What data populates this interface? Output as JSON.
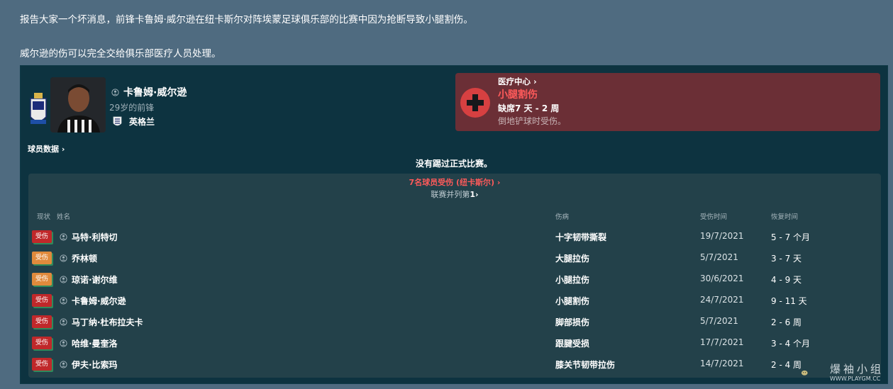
{
  "message": {
    "line1": "报告大家一个坏消息，前锋卡鲁姆·威尔逊在纽卡斯尔对阵埃蒙足球俱乐部的比赛中因为抢断导致小腿割伤。",
    "line2": "威尔逊的伤可以完全交给俱乐部医疗人员处理。"
  },
  "player": {
    "name": "卡鲁姆·威尔逊",
    "age_position": "29岁的前锋",
    "nation": "英格兰",
    "data_link": "球员数据 ›"
  },
  "medical": {
    "link": "医疗中心 ›",
    "injury": "小腿割伤",
    "absence": "缺席7 天 - 2 周",
    "cause": "倒地铲球时受伤。",
    "accent_color": "#d64041"
  },
  "no_match_text": "没有踢过正式比赛。",
  "injury_list": {
    "heading": "7名球员受伤 (纽卡斯尔) ›",
    "league_rank_prefix": "联赛并列第",
    "league_rank_value": "1",
    "league_rank_suffix": "›",
    "columns": {
      "status": "现状",
      "name": "姓名",
      "injury": "伤病",
      "date": "受伤时间",
      "recovery": "恢复时间"
    },
    "rows": [
      {
        "status": "受伤",
        "severity": "red",
        "name": "马特·利特切",
        "injury": "十字韧带撕裂",
        "date": "19/7/2021",
        "recovery": "5 - 7 个月"
      },
      {
        "status": "受伤",
        "severity": "orange",
        "name": "乔林顿",
        "injury": "大腿拉伤",
        "date": "5/7/2021",
        "recovery": "3 - 7 天"
      },
      {
        "status": "受伤",
        "severity": "orange",
        "name": "琼诺·谢尔维",
        "injury": "小腿拉伤",
        "date": "30/6/2021",
        "recovery": "4 - 9 天"
      },
      {
        "status": "受伤",
        "severity": "red",
        "name": "卡鲁姆·威尔逊",
        "injury": "小腿割伤",
        "date": "24/7/2021",
        "recovery": "9 - 11 天"
      },
      {
        "status": "受伤",
        "severity": "red",
        "name": "马丁纳·杜布拉夫卡",
        "injury": "脚部损伤",
        "date": "5/7/2021",
        "recovery": "2 - 6 周"
      },
      {
        "status": "受伤",
        "severity": "red",
        "name": "哈维·曼奎洛",
        "injury": "跟腱受损",
        "date": "17/7/2021",
        "recovery": "3 - 4 个月"
      },
      {
        "status": "受伤",
        "severity": "red",
        "name": "伊夫·比索玛",
        "injury": "膝关节韧带拉伤",
        "date": "14/7/2021",
        "recovery": "2 - 4 周"
      }
    ]
  },
  "watermark": {
    "text": "爆袖小组",
    "url": "WWW.PLAYGM.CC"
  }
}
